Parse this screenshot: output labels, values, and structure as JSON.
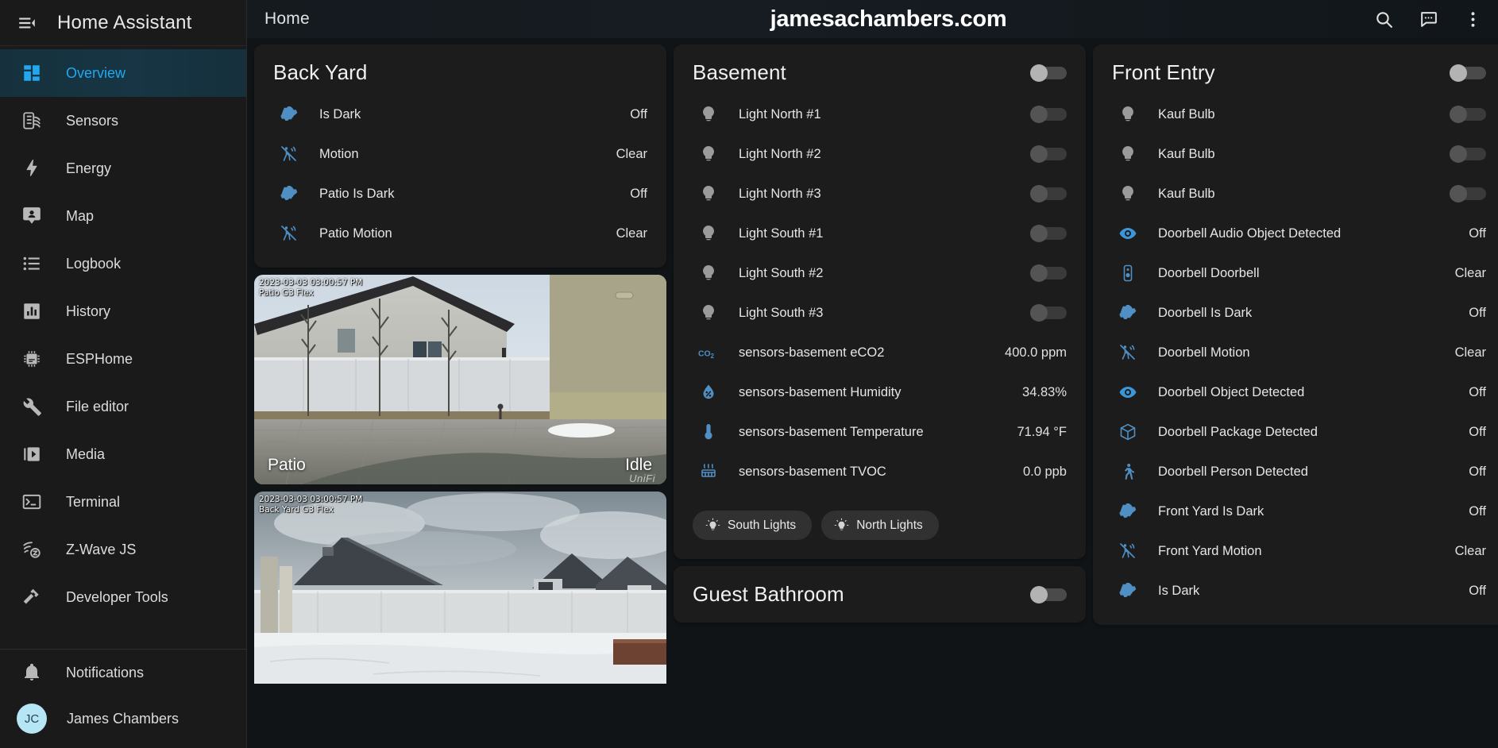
{
  "sidebar": {
    "title": "Home Assistant",
    "menu_icon": "hamburger-collapse-icon",
    "items": [
      {
        "label": "Overview",
        "icon": "view-dashboard-icon",
        "active": true
      },
      {
        "label": "Sensors",
        "icon": "sensors-icon",
        "active": false
      },
      {
        "label": "Energy",
        "icon": "lightning-bolt-icon",
        "active": false
      },
      {
        "label": "Map",
        "icon": "map-marker-account-icon",
        "active": false
      },
      {
        "label": "Logbook",
        "icon": "format-list-bulleted-icon",
        "active": false
      },
      {
        "label": "History",
        "icon": "chart-box-icon",
        "active": false
      },
      {
        "label": "ESPHome",
        "icon": "chip-icon",
        "active": false
      },
      {
        "label": "File editor",
        "icon": "wrench-icon",
        "active": false
      },
      {
        "label": "Media",
        "icon": "play-box-multiple-icon",
        "active": false
      },
      {
        "label": "Terminal",
        "icon": "console-icon",
        "active": false
      },
      {
        "label": "Z-Wave JS",
        "icon": "z-wave-icon",
        "active": false
      },
      {
        "label": "Developer Tools",
        "icon": "hammer-wrench-icon",
        "active": false
      }
    ],
    "bottom_items": [
      {
        "label": "Notifications",
        "icon": "bell-icon"
      }
    ],
    "user": {
      "label": "James Chambers",
      "initials": "JC"
    }
  },
  "topbar": {
    "view_name": "Home",
    "watermark": "jamesachambers.com",
    "actions": [
      {
        "name": "search-icon"
      },
      {
        "name": "assist-chat-icon"
      },
      {
        "name": "overflow-menu-icon"
      }
    ]
  },
  "cards": {
    "back_yard": {
      "title": "Back Yard",
      "rows": [
        {
          "icon": "brightness-icon",
          "name": "Is Dark",
          "value": "Off"
        },
        {
          "icon": "motion-sensor-off-icon",
          "name": "Motion",
          "value": "Clear"
        },
        {
          "icon": "brightness-icon",
          "name": "Patio Is Dark",
          "value": "Off"
        },
        {
          "icon": "motion-sensor-off-icon",
          "name": "Patio Motion",
          "value": "Clear"
        }
      ]
    },
    "camera_patio": {
      "timestamp": "2023-03-03 03:00:57 PM",
      "camera_name": "Patio G3 Flex",
      "label": "Patio",
      "status": "Idle",
      "brand": "UniFi"
    },
    "camera_backyard": {
      "timestamp": "2023-03-03 03:00:57 PM",
      "camera_name": "Back Yard G3 Flex"
    },
    "basement": {
      "title": "Basement",
      "header_toggle": "off",
      "rows": [
        {
          "icon": "lightbulb-icon",
          "name": "Light North #1",
          "control": "toggle",
          "state": "off"
        },
        {
          "icon": "lightbulb-icon",
          "name": "Light North #2",
          "control": "toggle",
          "state": "off"
        },
        {
          "icon": "lightbulb-icon",
          "name": "Light North #3",
          "control": "toggle",
          "state": "off"
        },
        {
          "icon": "lightbulb-icon",
          "name": "Light South #1",
          "control": "toggle",
          "state": "off"
        },
        {
          "icon": "lightbulb-icon",
          "name": "Light South #2",
          "control": "toggle",
          "state": "off"
        },
        {
          "icon": "lightbulb-icon",
          "name": "Light South #3",
          "control": "toggle",
          "state": "off"
        },
        {
          "icon": "molecule-co2-icon",
          "name": "sensors-basement eCO2",
          "value": "400.0 ppm"
        },
        {
          "icon": "water-percent-icon",
          "name": "sensors-basement Humidity",
          "value": "34.83%"
        },
        {
          "icon": "thermometer-icon",
          "name": "sensors-basement Temperature",
          "value": "71.94 °F"
        },
        {
          "icon": "radiator-icon",
          "name": "sensors-basement TVOC",
          "value": "0.0 ppb"
        }
      ],
      "chips": [
        {
          "icon": "lightbulb-on-icon",
          "label": "South Lights"
        },
        {
          "icon": "lightbulb-on-icon",
          "label": "North Lights"
        }
      ]
    },
    "guest_bathroom": {
      "title": "Guest Bathroom",
      "header_toggle": "off"
    },
    "front_entry": {
      "title": "Front Entry",
      "header_toggle": "off",
      "rows": [
        {
          "icon": "lightbulb-icon",
          "name": "Kauf Bulb",
          "control": "toggle",
          "state": "off"
        },
        {
          "icon": "lightbulb-icon",
          "name": "Kauf Bulb",
          "control": "toggle",
          "state": "off"
        },
        {
          "icon": "lightbulb-icon",
          "name": "Kauf Bulb",
          "control": "toggle",
          "state": "off"
        },
        {
          "icon": "eye-icon",
          "name": "Doorbell Audio Object Detected",
          "value": "Off"
        },
        {
          "icon": "doorbell-icon",
          "name": "Doorbell Doorbell",
          "value": "Clear"
        },
        {
          "icon": "brightness-icon",
          "name": "Doorbell Is Dark",
          "value": "Off"
        },
        {
          "icon": "motion-sensor-off-icon",
          "name": "Doorbell Motion",
          "value": "Clear"
        },
        {
          "icon": "eye-icon",
          "name": "Doorbell Object Detected",
          "value": "Off"
        },
        {
          "icon": "package-icon",
          "name": "Doorbell Package Detected",
          "value": "Off"
        },
        {
          "icon": "walk-icon",
          "name": "Doorbell Person Detected",
          "value": "Off"
        },
        {
          "icon": "brightness-icon",
          "name": "Front Yard Is Dark",
          "value": "Off"
        },
        {
          "icon": "motion-sensor-off-icon",
          "name": "Front Yard Motion",
          "value": "Clear"
        },
        {
          "icon": "brightness-icon",
          "name": "Is Dark",
          "value": "Off"
        }
      ]
    }
  },
  "colors": {
    "accent": "#22a7f0",
    "sensor_icon": "#4f8fc4",
    "card_bg": "#1c1c1c",
    "page_bg": "#111417",
    "sidebar_bg": "#1a1a1a"
  }
}
